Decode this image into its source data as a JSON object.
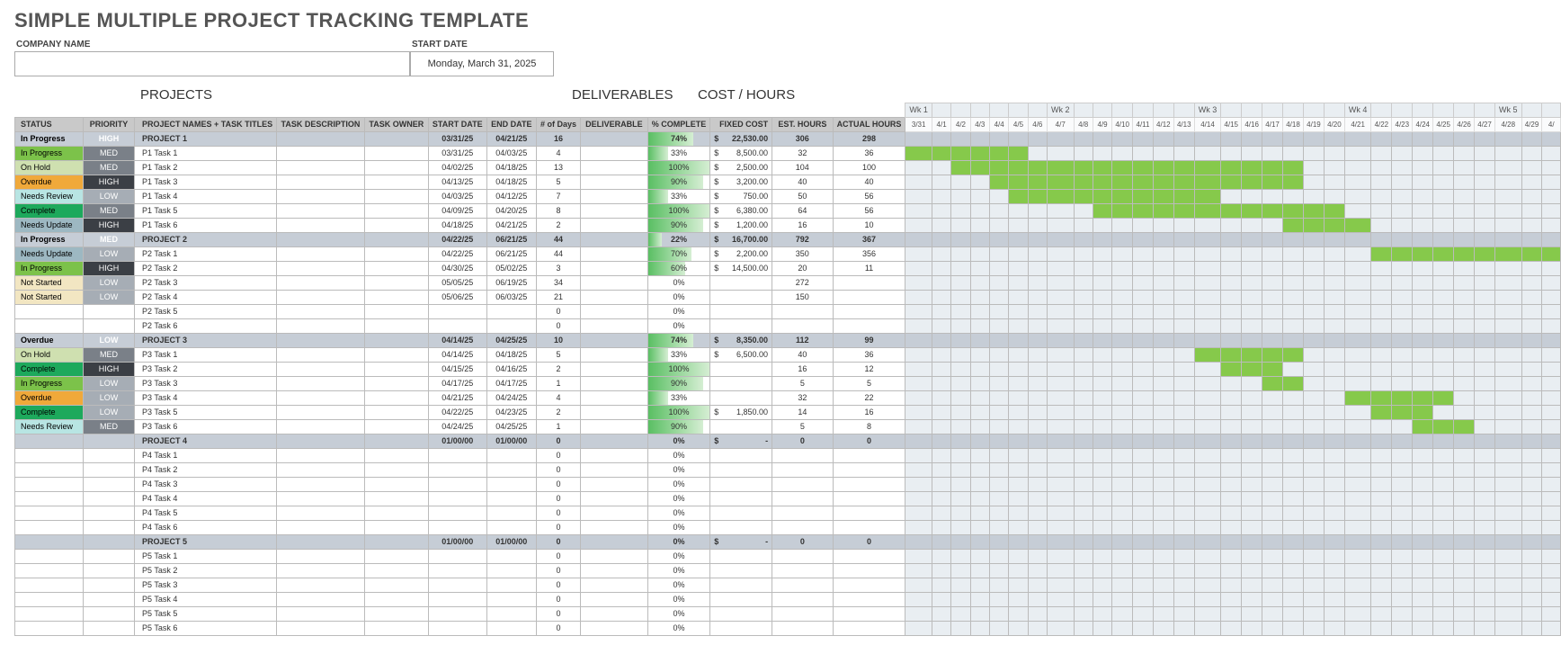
{
  "title": "SIMPLE MULTIPLE PROJECT TRACKING TEMPLATE",
  "company_label": "COMPANY NAME",
  "company_value": "",
  "start_date_label": "START DATE",
  "start_date_value": "Monday, March 31, 2025",
  "sections": {
    "projects": "PROJECTS",
    "deliverables": "DELIVERABLES",
    "cost": "COST / HOURS"
  },
  "columns": {
    "status": "STATUS",
    "priority": "PRIORITY",
    "name": "PROJECT NAMES + TASK TITLES",
    "desc": "TASK DESCRIPTION",
    "owner": "TASK OWNER",
    "start": "START DATE",
    "end": "END DATE",
    "days": "# of Days",
    "deliv": "DELIVERABLE",
    "pct": "% COMPLETE",
    "fixed": "FIXED COST",
    "est": "EST. HOURS",
    "act": "ACTUAL HOURS"
  },
  "weeks": [
    "Wk 1",
    "Wk 2",
    "Wk 3",
    "Wk 4",
    "Wk 5"
  ],
  "days": [
    "3/31",
    "4/1",
    "4/2",
    "4/3",
    "4/4",
    "4/5",
    "4/6",
    "4/7",
    "4/8",
    "4/9",
    "4/10",
    "4/11",
    "4/12",
    "4/13",
    "4/14",
    "4/15",
    "4/16",
    "4/17",
    "4/18",
    "4/19",
    "4/20",
    "4/21",
    "4/22",
    "4/23",
    "4/24",
    "4/25",
    "4/26",
    "4/27",
    "4/28",
    "4/29",
    "4/"
  ],
  "status_colors": {
    "In Progress": "st-InProgress",
    "On Hold": "st-OnHold",
    "Overdue": "st-Overdue",
    "Needs Review": "st-NeedsReview",
    "Complete": "st-Complete",
    "Needs Update": "st-NeedsUpdate",
    "Not Started": "st-NotStarted"
  },
  "priority_colors": {
    "HIGH": "pri-hi",
    "MED": "pri-md",
    "LOW": "pri-lo"
  },
  "rows": [
    {
      "type": "project",
      "status": "In Progress",
      "priority": "HIGH",
      "name": "PROJECT 1",
      "start": "03/31/25",
      "end": "04/21/25",
      "days": "16",
      "pct": 74,
      "fixed": "22,530.00",
      "est": "306",
      "act": "298",
      "g": [
        0,
        21
      ]
    },
    {
      "type": "task",
      "status": "In Progress",
      "priority": "MED",
      "name": "P1 Task 1",
      "start": "03/31/25",
      "end": "04/03/25",
      "days": "4",
      "pct": 33,
      "fixed": "8,500.00",
      "est": "32",
      "act": "36",
      "g": [
        0,
        5
      ]
    },
    {
      "type": "task",
      "status": "On Hold",
      "priority": "MED",
      "name": "P1 Task 2",
      "start": "04/02/25",
      "end": "04/18/25",
      "days": "13",
      "pct": 100,
      "fixed": "2,500.00",
      "est": "104",
      "act": "100",
      "g": [
        2,
        18
      ]
    },
    {
      "type": "task",
      "status": "Overdue",
      "priority": "HIGH",
      "name": "P1 Task 3",
      "start": "04/13/25",
      "end": "04/18/25",
      "days": "5",
      "pct": 90,
      "fixed": "3,200.00",
      "est": "40",
      "act": "40",
      "g": [
        4,
        18
      ]
    },
    {
      "type": "task",
      "status": "Needs Review",
      "priority": "LOW",
      "name": "P1 Task 4",
      "start": "04/03/25",
      "end": "04/12/25",
      "days": "7",
      "pct": 33,
      "fixed": "750.00",
      "est": "50",
      "act": "56",
      "g": [
        5,
        14
      ]
    },
    {
      "type": "task",
      "status": "Complete",
      "priority": "MED",
      "name": "P1 Task 5",
      "start": "04/09/25",
      "end": "04/20/25",
      "days": "8",
      "pct": 100,
      "fixed": "6,380.00",
      "est": "64",
      "act": "56",
      "g": [
        9,
        20
      ]
    },
    {
      "type": "task",
      "status": "Needs Update",
      "priority": "HIGH",
      "name": "P1 Task 6",
      "start": "04/18/25",
      "end": "04/21/25",
      "days": "2",
      "pct": 90,
      "fixed": "1,200.00",
      "est": "16",
      "act": "10",
      "g": [
        18,
        21
      ]
    },
    {
      "type": "project",
      "status": "In Progress",
      "priority": "MED",
      "name": "PROJECT 2",
      "start": "04/22/25",
      "end": "06/21/25",
      "days": "44",
      "pct": 22,
      "fixed": "16,700.00",
      "est": "792",
      "act": "367",
      "g": [
        22,
        31
      ]
    },
    {
      "type": "task",
      "status": "Needs Update",
      "priority": "LOW",
      "name": "P2 Task 1",
      "start": "04/22/25",
      "end": "06/21/25",
      "days": "44",
      "pct": 70,
      "fixed": "2,200.00",
      "est": "350",
      "act": "356",
      "g": [
        22,
        31
      ]
    },
    {
      "type": "task",
      "status": "In Progress",
      "priority": "HIGH",
      "name": "P2 Task 2",
      "start": "04/30/25",
      "end": "05/02/25",
      "days": "3",
      "pct": 60,
      "fixed": "14,500.00",
      "est": "20",
      "act": "11",
      "g": null
    },
    {
      "type": "task",
      "status": "Not Started",
      "priority": "LOW",
      "name": "P2 Task 3",
      "start": "05/05/25",
      "end": "06/19/25",
      "days": "34",
      "pct": 0,
      "fixed": "",
      "est": "272",
      "act": "",
      "g": null
    },
    {
      "type": "task",
      "status": "Not Started",
      "priority": "LOW",
      "name": "P2 Task 4",
      "start": "05/06/25",
      "end": "06/03/25",
      "days": "21",
      "pct": 0,
      "fixed": "",
      "est": "150",
      "act": "",
      "g": null
    },
    {
      "type": "task",
      "status": "",
      "priority": "",
      "name": "P2 Task 5",
      "start": "",
      "end": "",
      "days": "0",
      "pct": 0,
      "fixed": "",
      "est": "",
      "act": "",
      "g": null
    },
    {
      "type": "task",
      "status": "",
      "priority": "",
      "name": "P2 Task 6",
      "start": "",
      "end": "",
      "days": "0",
      "pct": 0,
      "fixed": "",
      "est": "",
      "act": "",
      "g": null
    },
    {
      "type": "project",
      "status": "Overdue",
      "priority": "LOW",
      "name": "PROJECT 3",
      "start": "04/14/25",
      "end": "04/25/25",
      "days": "10",
      "pct": 74,
      "fixed": "8,350.00",
      "est": "112",
      "act": "99",
      "g": [
        14,
        25
      ]
    },
    {
      "type": "task",
      "status": "On Hold",
      "priority": "MED",
      "name": "P3 Task 1",
      "start": "04/14/25",
      "end": "04/18/25",
      "days": "5",
      "pct": 33,
      "fixed": "6,500.00",
      "est": "40",
      "act": "36",
      "g": [
        14,
        18
      ]
    },
    {
      "type": "task",
      "status": "Complete",
      "priority": "HIGH",
      "name": "P3 Task 2",
      "start": "04/15/25",
      "end": "04/16/25",
      "days": "2",
      "pct": 100,
      "fixed": "",
      "est": "16",
      "act": "12",
      "g": [
        15,
        17
      ]
    },
    {
      "type": "task",
      "status": "In Progress",
      "priority": "LOW",
      "name": "P3 Task 3",
      "start": "04/17/25",
      "end": "04/17/25",
      "days": "1",
      "pct": 90,
      "fixed": "",
      "est": "5",
      "act": "5",
      "g": [
        17,
        18
      ]
    },
    {
      "type": "task",
      "status": "Overdue",
      "priority": "LOW",
      "name": "P3 Task 4",
      "start": "04/21/25",
      "end": "04/24/25",
      "days": "4",
      "pct": 33,
      "fixed": "",
      "est": "32",
      "act": "22",
      "g": [
        21,
        25
      ]
    },
    {
      "type": "task",
      "status": "Complete",
      "priority": "LOW",
      "name": "P3 Task 5",
      "start": "04/22/25",
      "end": "04/23/25",
      "days": "2",
      "pct": 100,
      "fixed": "1,850.00",
      "est": "14",
      "act": "16",
      "g": [
        22,
        24
      ]
    },
    {
      "type": "task",
      "status": "Needs Review",
      "priority": "MED",
      "name": "P3 Task 6",
      "start": "04/24/25",
      "end": "04/25/25",
      "days": "1",
      "pct": 90,
      "fixed": "",
      "est": "5",
      "act": "8",
      "g": [
        24,
        26
      ]
    },
    {
      "type": "project",
      "status": "",
      "priority": "",
      "name": "PROJECT 4",
      "start": "01/00/00",
      "end": "01/00/00",
      "days": "0",
      "pct": 0,
      "fixed": "-",
      "est": "0",
      "act": "0",
      "g": null
    },
    {
      "type": "task",
      "status": "",
      "priority": "",
      "name": "P4 Task 1",
      "start": "",
      "end": "",
      "days": "0",
      "pct": 0,
      "fixed": "",
      "est": "",
      "act": "",
      "g": null
    },
    {
      "type": "task",
      "status": "",
      "priority": "",
      "name": "P4 Task 2",
      "start": "",
      "end": "",
      "days": "0",
      "pct": 0,
      "fixed": "",
      "est": "",
      "act": "",
      "g": null
    },
    {
      "type": "task",
      "status": "",
      "priority": "",
      "name": "P4 Task 3",
      "start": "",
      "end": "",
      "days": "0",
      "pct": 0,
      "fixed": "",
      "est": "",
      "act": "",
      "g": null
    },
    {
      "type": "task",
      "status": "",
      "priority": "",
      "name": "P4 Task 4",
      "start": "",
      "end": "",
      "days": "0",
      "pct": 0,
      "fixed": "",
      "est": "",
      "act": "",
      "g": null
    },
    {
      "type": "task",
      "status": "",
      "priority": "",
      "name": "P4 Task 5",
      "start": "",
      "end": "",
      "days": "0",
      "pct": 0,
      "fixed": "",
      "est": "",
      "act": "",
      "g": null
    },
    {
      "type": "task",
      "status": "",
      "priority": "",
      "name": "P4 Task 6",
      "start": "",
      "end": "",
      "days": "0",
      "pct": 0,
      "fixed": "",
      "est": "",
      "act": "",
      "g": null
    },
    {
      "type": "project",
      "status": "",
      "priority": "",
      "name": "PROJECT 5",
      "start": "01/00/00",
      "end": "01/00/00",
      "days": "0",
      "pct": 0,
      "fixed": "-",
      "est": "0",
      "act": "0",
      "g": null
    },
    {
      "type": "task",
      "status": "",
      "priority": "",
      "name": "P5 Task 1",
      "start": "",
      "end": "",
      "days": "0",
      "pct": 0,
      "fixed": "",
      "est": "",
      "act": "",
      "g": null
    },
    {
      "type": "task",
      "status": "",
      "priority": "",
      "name": "P5 Task 2",
      "start": "",
      "end": "",
      "days": "0",
      "pct": 0,
      "fixed": "",
      "est": "",
      "act": "",
      "g": null
    },
    {
      "type": "task",
      "status": "",
      "priority": "",
      "name": "P5 Task 3",
      "start": "",
      "end": "",
      "days": "0",
      "pct": 0,
      "fixed": "",
      "est": "",
      "act": "",
      "g": null
    },
    {
      "type": "task",
      "status": "",
      "priority": "",
      "name": "P5 Task 4",
      "start": "",
      "end": "",
      "days": "0",
      "pct": 0,
      "fixed": "",
      "est": "",
      "act": "",
      "g": null
    },
    {
      "type": "task",
      "status": "",
      "priority": "",
      "name": "P5 Task 5",
      "start": "",
      "end": "",
      "days": "0",
      "pct": 0,
      "fixed": "",
      "est": "",
      "act": "",
      "g": null
    },
    {
      "type": "task",
      "status": "",
      "priority": "",
      "name": "P5 Task 6",
      "start": "",
      "end": "",
      "days": "0",
      "pct": 0,
      "fixed": "",
      "est": "",
      "act": "",
      "g": null
    }
  ]
}
